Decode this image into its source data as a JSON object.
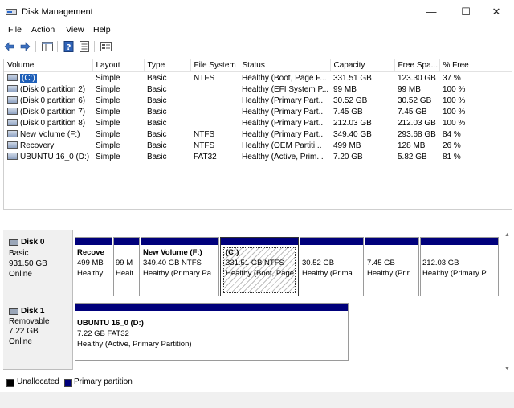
{
  "window": {
    "title": "Disk Management",
    "controls": {
      "minimize": "—",
      "maximize": "☐",
      "close": "✕"
    }
  },
  "menu": [
    "File",
    "Action",
    "View",
    "Help"
  ],
  "table": {
    "headers": [
      "Volume",
      "Layout",
      "Type",
      "File System",
      "Status",
      "Capacity",
      "Free Spa...",
      "% Free"
    ],
    "rows": [
      [
        "(C:)",
        "Simple",
        "Basic",
        "NTFS",
        "Healthy (Boot, Page F...",
        "331.51 GB",
        "123.30 GB",
        "37 %"
      ],
      [
        "(Disk 0 partition 2)",
        "Simple",
        "Basic",
        "",
        "Healthy (EFI System P...",
        "99 MB",
        "99 MB",
        "100 %"
      ],
      [
        "(Disk 0 partition 6)",
        "Simple",
        "Basic",
        "",
        "Healthy (Primary Part...",
        "30.52 GB",
        "30.52 GB",
        "100 %"
      ],
      [
        "(Disk 0 partition 7)",
        "Simple",
        "Basic",
        "",
        "Healthy (Primary Part...",
        "7.45 GB",
        "7.45 GB",
        "100 %"
      ],
      [
        "(Disk 0 partition 8)",
        "Simple",
        "Basic",
        "",
        "Healthy (Primary Part...",
        "212.03 GB",
        "212.03 GB",
        "100 %"
      ],
      [
        "New Volume (F:)",
        "Simple",
        "Basic",
        "NTFS",
        "Healthy (Primary Part...",
        "349.40 GB",
        "293.68 GB",
        "84 %"
      ],
      [
        "Recovery",
        "Simple",
        "Basic",
        "NTFS",
        "Healthy (OEM Partiti...",
        "499 MB",
        "128 MB",
        "26 %"
      ],
      [
        "UBUNTU 16_0 (D:)",
        "Simple",
        "Basic",
        "FAT32",
        "Healthy (Active, Prim...",
        "7.20 GB",
        "5.82 GB",
        "81 %"
      ]
    ]
  },
  "disks": [
    {
      "name": "Disk 0",
      "type": "Basic",
      "size": "931.50 GB",
      "state": "Online",
      "partitions": [
        {
          "label": "Recove",
          "size": "499 MB",
          "status": "Healthy"
        },
        {
          "label": "",
          "size": "99 M",
          "status": "Healt"
        },
        {
          "label": "New Volume  (F:)",
          "size": "349.40 GB NTFS",
          "status": "Healthy (Primary Pa"
        },
        {
          "label": "(C:)",
          "size": "331.51 GB NTFS",
          "status": "Healthy (Boot, Page"
        },
        {
          "label": "",
          "size": "30.52 GB",
          "status": "Healthy (Prima"
        },
        {
          "label": "",
          "size": "7.45 GB",
          "status": "Healthy (Prir"
        },
        {
          "label": "",
          "size": "212.03 GB",
          "status": "Healthy (Primary P"
        }
      ]
    },
    {
      "name": "Disk 1",
      "type": "Removable",
      "size": "7.22 GB",
      "state": "Online",
      "partitions": [
        {
          "label": "UBUNTU 16_0  (D:)",
          "size": "7.22 GB FAT32",
          "status": "Healthy (Active, Primary Partition)"
        }
      ]
    }
  ],
  "legend": [
    {
      "label": "Unallocated",
      "color": "#000000"
    },
    {
      "label": "Primary partition",
      "color": "#00007b"
    }
  ],
  "colors": {
    "partition_bar": "#00007b",
    "selection": "#1e5fb8"
  }
}
